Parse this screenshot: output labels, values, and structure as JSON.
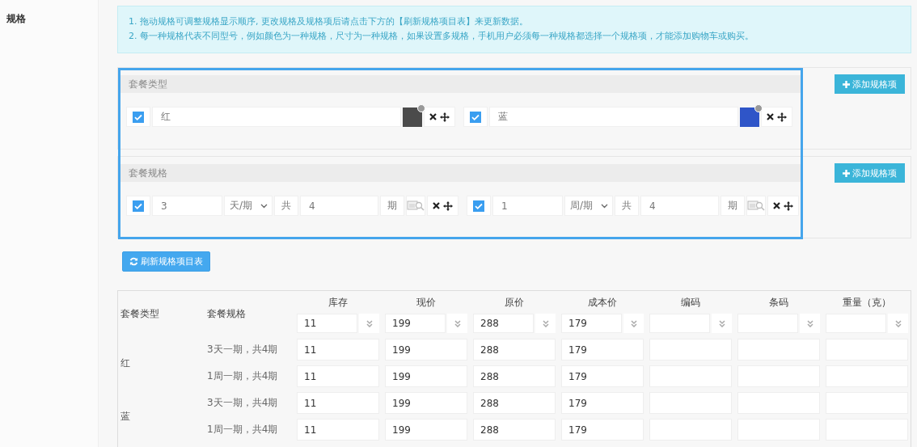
{
  "section_label": "规格",
  "notice": [
    "1. 拖动规格可调整规格显示顺序, 更改规格及规格项后请点击下方的【刷新规格项目表】来更新数据。",
    "2. 每一种规格代表不同型号，例如颜色为一种规格，尺寸为一种规格，如果设置多规格，手机用户必须每一种规格都选择一个规格项，才能添加购物车或购买。"
  ],
  "spec_groups": [
    {
      "title": "套餐类型",
      "add_button": "添加规格项",
      "items": [
        {
          "kind": "image",
          "checked": true,
          "value": "红"
        },
        {
          "kind": "image",
          "checked": true,
          "value": "蓝"
        }
      ]
    },
    {
      "title": "套餐规格",
      "add_button": "添加规格项",
      "items": [
        {
          "kind": "period",
          "checked": true,
          "value": "3",
          "unit": "天/期",
          "prefix": "共",
          "count": "4",
          "suffix": "期"
        },
        {
          "kind": "period",
          "checked": true,
          "value": "1",
          "unit": "周/期",
          "prefix": "共",
          "count": "4",
          "suffix": "期"
        }
      ]
    }
  ],
  "refresh_button": "刷新规格项目表",
  "table": {
    "columns": [
      "套餐类型",
      "套餐规格"
    ],
    "value_columns": [
      {
        "title": "库存",
        "batch_value": "11"
      },
      {
        "title": "现价",
        "batch_value": "199"
      },
      {
        "title": "原价",
        "batch_value": "288"
      },
      {
        "title": "成本价",
        "batch_value": "179"
      },
      {
        "title": "编码"
      },
      {
        "title": "条码"
      },
      {
        "title": "重量（克）"
      }
    ],
    "rows": [
      {
        "type": "红",
        "specs": [
          {
            "spec": "3天一期，共4期",
            "values": [
              "11",
              "199",
              "288",
              "179"
            ]
          },
          {
            "spec": "1周一期，共4期",
            "values": [
              "11",
              "199",
              "288",
              "179"
            ]
          }
        ]
      },
      {
        "type": "蓝",
        "specs": [
          {
            "spec": "3天一期，共4期",
            "values": [
              "11",
              "199",
              "288",
              "179"
            ]
          },
          {
            "spec": "1周一期，共4期",
            "values": [
              "11",
              "199",
              "288",
              "179"
            ]
          }
        ]
      }
    ]
  }
}
